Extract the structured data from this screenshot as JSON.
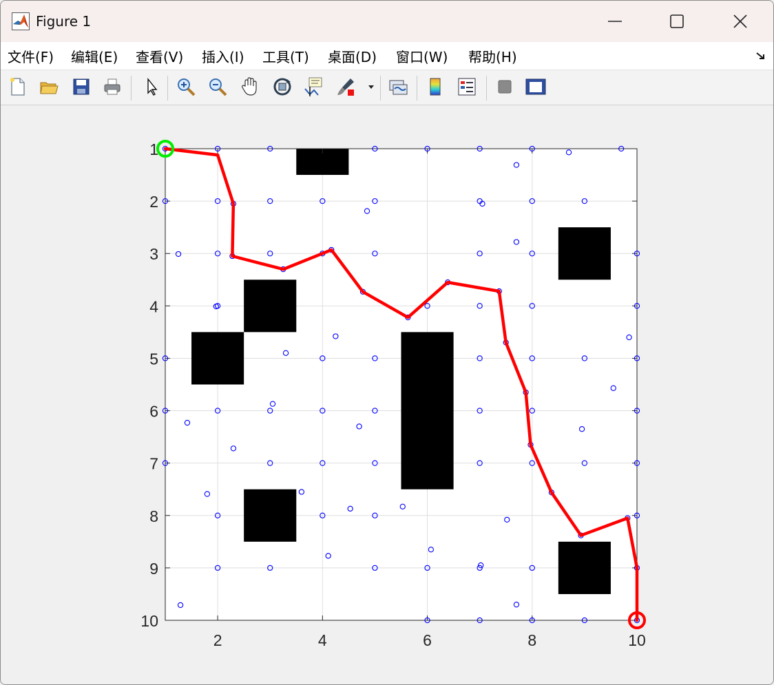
{
  "window": {
    "title": "Figure 1",
    "minimize_icon": "minimize-icon",
    "maximize_icon": "maximize-icon",
    "close_icon": "close-icon"
  },
  "menu": {
    "items": [
      {
        "label": "文件(F)"
      },
      {
        "label": "编辑(E)"
      },
      {
        "label": "查看(V)"
      },
      {
        "label": "插入(I)"
      },
      {
        "label": "工具(T)"
      },
      {
        "label": "桌面(D)"
      },
      {
        "label": "窗口(W)"
      },
      {
        "label": "帮助(H)"
      }
    ]
  },
  "toolbar": {
    "icons": [
      "new-figure-icon",
      "open-file-icon",
      "save-icon",
      "print-icon",
      "pointer-icon",
      "zoom-in-icon",
      "zoom-out-icon",
      "pan-icon",
      "rotate-3d-icon",
      "data-cursor-icon",
      "brush-icon",
      "brush-dropdown-icon",
      "link-plot-icon",
      "colorbar-icon",
      "legend-icon",
      "hide-plot-tools-icon",
      "show-plot-tools-icon"
    ]
  },
  "chart_data": {
    "type": "scatter",
    "title": "",
    "xlabel": "",
    "ylabel": "",
    "xlim": [
      1,
      10
    ],
    "ylim": [
      10,
      1
    ],
    "y_reversed": true,
    "grid": true,
    "xticks": [
      2,
      4,
      6,
      8,
      10
    ],
    "yticks": [
      1,
      2,
      3,
      4,
      5,
      6,
      7,
      8,
      9,
      10
    ],
    "colors": {
      "nodes": "#0000ff",
      "path": "#ff0000",
      "obstacles": "#000000",
      "start_marker": "#00ee00",
      "goal_marker": "#ff0000",
      "grid": "#dedede"
    },
    "obstacles": [
      {
        "x": [
          3.5,
          4.5
        ],
        "y": [
          0.5,
          1.5
        ]
      },
      {
        "x": [
          8.5,
          9.5
        ],
        "y": [
          2.5,
          3.5
        ]
      },
      {
        "x": [
          2.5,
          3.5
        ],
        "y": [
          3.5,
          4.5
        ]
      },
      {
        "x": [
          1.5,
          2.5
        ],
        "y": [
          4.5,
          5.5
        ]
      },
      {
        "x": [
          5.5,
          6.5
        ],
        "y": [
          4.5,
          7.5
        ]
      },
      {
        "x": [
          2.5,
          3.5
        ],
        "y": [
          7.5,
          8.5
        ]
      },
      {
        "x": [
          8.5,
          9.5
        ],
        "y": [
          8.5,
          9.5
        ]
      }
    ],
    "nodes": [
      [
        1,
        1
      ],
      [
        2,
        1
      ],
      [
        3,
        1
      ],
      [
        5,
        1
      ],
      [
        6,
        1
      ],
      [
        7,
        1
      ],
      [
        8,
        1
      ],
      [
        8.7,
        1.07
      ],
      [
        9.7,
        1
      ],
      [
        7.7,
        1.31
      ],
      [
        1,
        2
      ],
      [
        2,
        2
      ],
      [
        2.3,
        2.05
      ],
      [
        3,
        2
      ],
      [
        4,
        2
      ],
      [
        5,
        2
      ],
      [
        4.85,
        2.19
      ],
      [
        7,
        2
      ],
      [
        7.05,
        2.05
      ],
      [
        8,
        2
      ],
      [
        9,
        2
      ],
      [
        1.25,
        3.01
      ],
      [
        2,
        3
      ],
      [
        2.28,
        3.05
      ],
      [
        3,
        3
      ],
      [
        3.25,
        3.3
      ],
      [
        4,
        3
      ],
      [
        4.17,
        2.93
      ],
      [
        5,
        3
      ],
      [
        7,
        3
      ],
      [
        7.7,
        2.78
      ],
      [
        8,
        3
      ],
      [
        10,
        3
      ],
      [
        2,
        4
      ],
      [
        1.97,
        4.01
      ],
      [
        4.77,
        3.73
      ],
      [
        5.63,
        4.22
      ],
      [
        6,
        4
      ],
      [
        6.39,
        3.55
      ],
      [
        7,
        4
      ],
      [
        7.37,
        3.72
      ],
      [
        8,
        4
      ],
      [
        10,
        4
      ],
      [
        1,
        5
      ],
      [
        3.3,
        4.9
      ],
      [
        4,
        5
      ],
      [
        4.25,
        4.58
      ],
      [
        5,
        5
      ],
      [
        7,
        5
      ],
      [
        7.5,
        4.7
      ],
      [
        8,
        5
      ],
      [
        9,
        5
      ],
      [
        9.85,
        4.6
      ],
      [
        10,
        5
      ],
      [
        1,
        6
      ],
      [
        1.42,
        6.23
      ],
      [
        2,
        6
      ],
      [
        3,
        6
      ],
      [
        3.05,
        5.87
      ],
      [
        4,
        6
      ],
      [
        4.7,
        6.3
      ],
      [
        5,
        6
      ],
      [
        7,
        6
      ],
      [
        7.88,
        5.65
      ],
      [
        8,
        6
      ],
      [
        8.95,
        6.35
      ],
      [
        9.55,
        5.57
      ],
      [
        10,
        6
      ],
      [
        1,
        7
      ],
      [
        2.3,
        6.72
      ],
      [
        3,
        7
      ],
      [
        4,
        7
      ],
      [
        5,
        7
      ],
      [
        7,
        7
      ],
      [
        7.97,
        6.65
      ],
      [
        8,
        7
      ],
      [
        9,
        7
      ],
      [
        10,
        7
      ],
      [
        1.8,
        7.59
      ],
      [
        2,
        8
      ],
      [
        3.6,
        7.55
      ],
      [
        4,
        8
      ],
      [
        4.53,
        7.87
      ],
      [
        5,
        8
      ],
      [
        5.53,
        7.83
      ],
      [
        7.52,
        8.08
      ],
      [
        8.37,
        7.56
      ],
      [
        8.93,
        8.38
      ],
      [
        9.82,
        8.05
      ],
      [
        10,
        8
      ],
      [
        2,
        9
      ],
      [
        3,
        9
      ],
      [
        4.11,
        8.77
      ],
      [
        5,
        9
      ],
      [
        6,
        9
      ],
      [
        6.07,
        8.65
      ],
      [
        7,
        9
      ],
      [
        7.02,
        8.95
      ],
      [
        8,
        9
      ],
      [
        10,
        9
      ],
      [
        1.29,
        9.71
      ],
      [
        6,
        10
      ],
      [
        7,
        10
      ],
      [
        7.7,
        9.7
      ],
      [
        8,
        10
      ],
      [
        9,
        10
      ],
      [
        10,
        10
      ]
    ],
    "path": [
      [
        1,
        1
      ],
      [
        2,
        1.12
      ],
      [
        2.3,
        2.05
      ],
      [
        2.28,
        3.05
      ],
      [
        3.25,
        3.3
      ],
      [
        4,
        3
      ],
      [
        4.17,
        2.93
      ],
      [
        4.77,
        3.73
      ],
      [
        5.63,
        4.22
      ],
      [
        6.39,
        3.55
      ],
      [
        7.37,
        3.72
      ],
      [
        7.5,
        4.7
      ],
      [
        7.88,
        5.65
      ],
      [
        7.97,
        6.65
      ],
      [
        8.37,
        7.56
      ],
      [
        8.93,
        8.38
      ],
      [
        9.82,
        8.05
      ],
      [
        10,
        9
      ],
      [
        10,
        10
      ]
    ],
    "start": [
      1,
      1
    ],
    "goal": [
      10,
      10
    ]
  }
}
